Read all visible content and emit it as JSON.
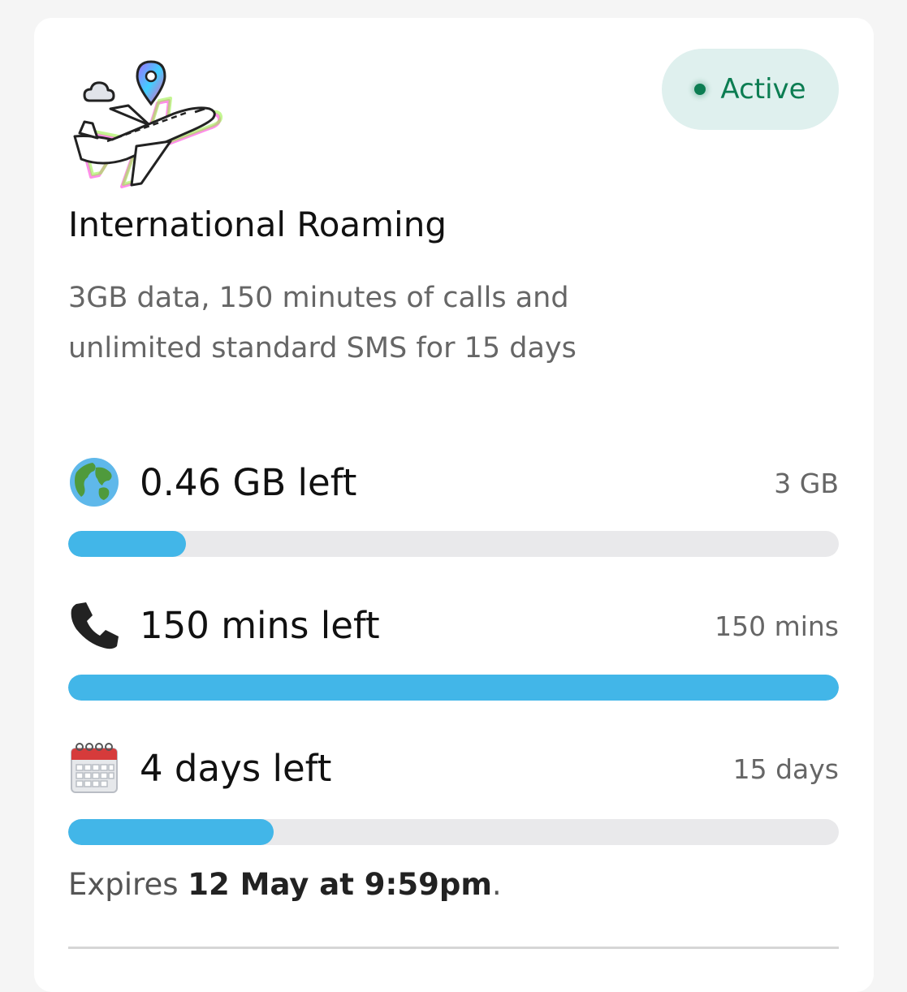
{
  "plan": {
    "title": "International Roaming",
    "description": "3GB data, 150 minutes of calls and unlimited standard SMS for 15 days",
    "hero_icon": "airplane-location-icon",
    "status": {
      "label": "Active",
      "color": "#0c7d52",
      "background": "#dff0ee"
    }
  },
  "usage": [
    {
      "icon": "globe-icon",
      "remaining_label": "0.46 GB left",
      "total_label": "3 GB",
      "fraction_remaining": 0.153
    },
    {
      "icon": "phone-icon",
      "remaining_label": "150 mins left",
      "total_label": "150 mins",
      "fraction_remaining": 1.0
    },
    {
      "icon": "calendar-icon",
      "remaining_label": "4 days left",
      "total_label": "15 days",
      "fraction_remaining": 0.267
    }
  ],
  "expiry": {
    "prefix": "Expires",
    "value": "12 May at 9:59pm",
    "suffix": "."
  },
  "colors": {
    "bar_fill": "#42b6e8",
    "bar_track": "#e9e9eb"
  }
}
